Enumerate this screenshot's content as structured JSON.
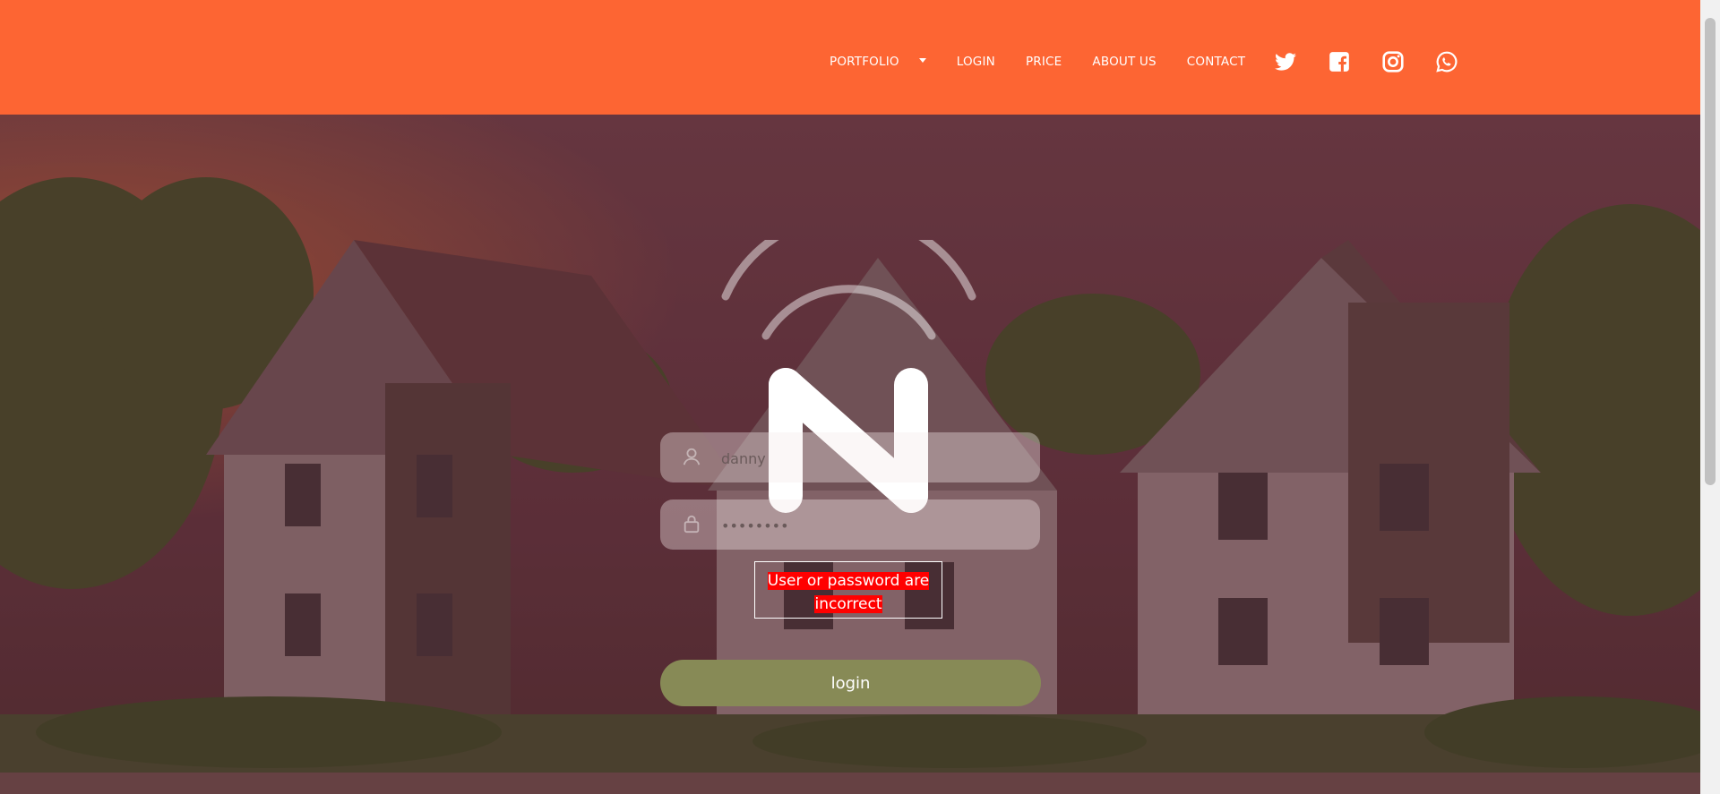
{
  "header": {
    "nav": [
      {
        "label": "PORTFOLIO",
        "has_dropdown": true
      },
      {
        "label": "LOGIN"
      },
      {
        "label": "PRICE"
      },
      {
        "label": "ABOUT US"
      },
      {
        "label": "CONTACT"
      }
    ],
    "social": [
      "twitter-icon",
      "facebook-icon",
      "instagram-icon",
      "whatsapp-icon"
    ],
    "background_color": "#fd6533"
  },
  "login_form": {
    "username_value": "danny",
    "password_value": "••••••••",
    "error_message": "User or password are incorrect",
    "submit_label": "login",
    "button_color": "#878a56",
    "error_color": "#ff0000"
  }
}
